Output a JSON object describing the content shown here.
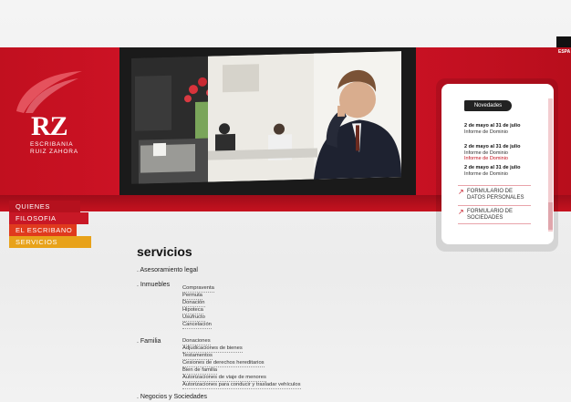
{
  "lang": "ESPA",
  "logo": {
    "initials": "RZ",
    "line1": "ESCRIBANIA",
    "line2": "RUIZ ZAHORA"
  },
  "nav": [
    "QUIENES SOMOS",
    "FILOSOFIA",
    "EL ESCRIBANO",
    "SERVICIOS"
  ],
  "sidebar": {
    "tab": "Novedades",
    "news": [
      {
        "date": "2 de mayo al 31 de julio",
        "lines": [
          "Informe de Dominio"
        ]
      },
      {
        "date": "2 de mayo al 31 de julio",
        "lines": [
          "Informe de Dominio",
          "Informe de Dominio"
        ]
      },
      {
        "date": "2 de mayo al 31 de julio",
        "lines": [
          "Informe de Dominio"
        ]
      }
    ],
    "links": [
      [
        "FORMULARIO DE",
        "DATOS PERSONALES"
      ],
      [
        "FORMULARIO DE",
        "SOCIEDADES"
      ]
    ]
  },
  "content": {
    "title": "servicios",
    "sections": [
      {
        "label": ". Asesoramiento legal",
        "items": []
      },
      {
        "label": ". Inmuebles",
        "items": [
          "Compraventa",
          "Permuta",
          "Donación",
          "Hipoteca",
          "Usufructo",
          "Cancelación"
        ]
      },
      {
        "label": ". Familia",
        "items": [
          "Donaciones",
          "Adjudicaciones de bienes",
          "Testamentos",
          "Cesiones de derechos hereditarios",
          "Bien de familia",
          "Autorizaciones de viaje de menores",
          "Autorizaciones para conducir y trasladar vehículos"
        ]
      },
      {
        "label": ". Negocios y Sociedades",
        "items": []
      }
    ]
  },
  "colors": {
    "brand_red": "#c4121f",
    "nav": [
      "#b5111e",
      "#c81826",
      "#e03a1d",
      "#e8a21a"
    ]
  }
}
